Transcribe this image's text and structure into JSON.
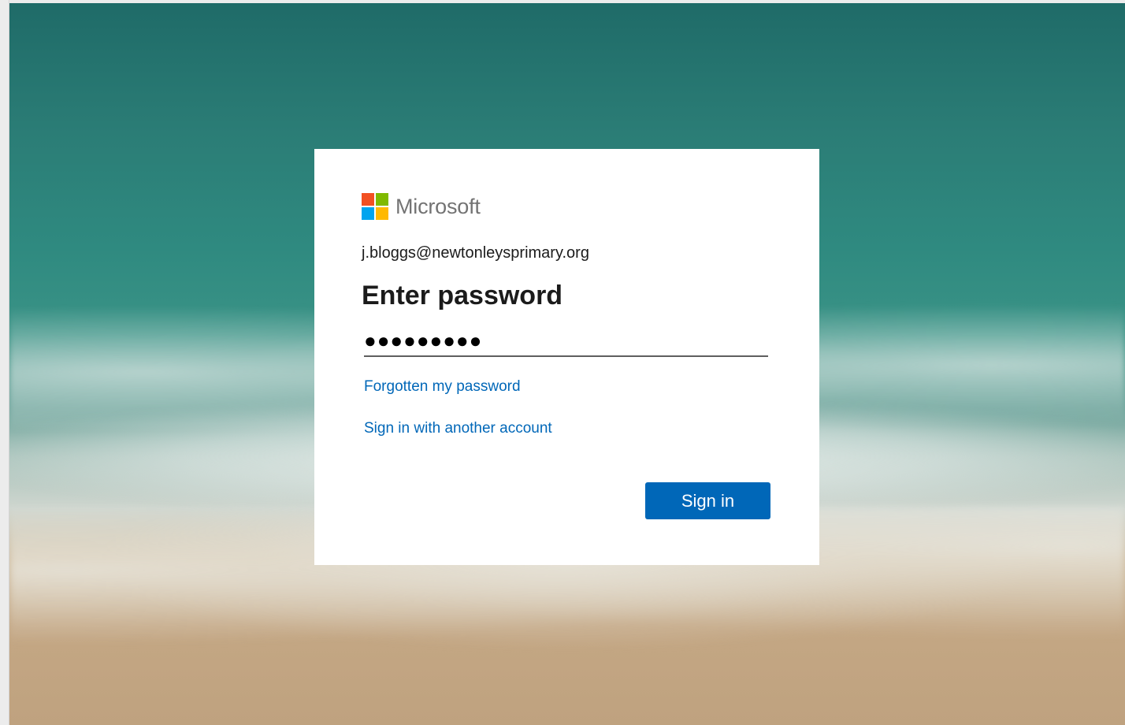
{
  "brand": {
    "name": "Microsoft",
    "logo_colors": [
      "#f25022",
      "#7fba00",
      "#00a4ef",
      "#ffb900"
    ]
  },
  "signin": {
    "email": "j.bloggs@newtonleysprimary.org",
    "title": "Enter password",
    "password_masked": "●●●●●●●●●",
    "forgot_link": "Forgotten my password",
    "other_account_link": "Sign in with another account",
    "submit_label": "Sign in"
  },
  "colors": {
    "accent": "#0067b8",
    "card_background": "#ffffff"
  }
}
